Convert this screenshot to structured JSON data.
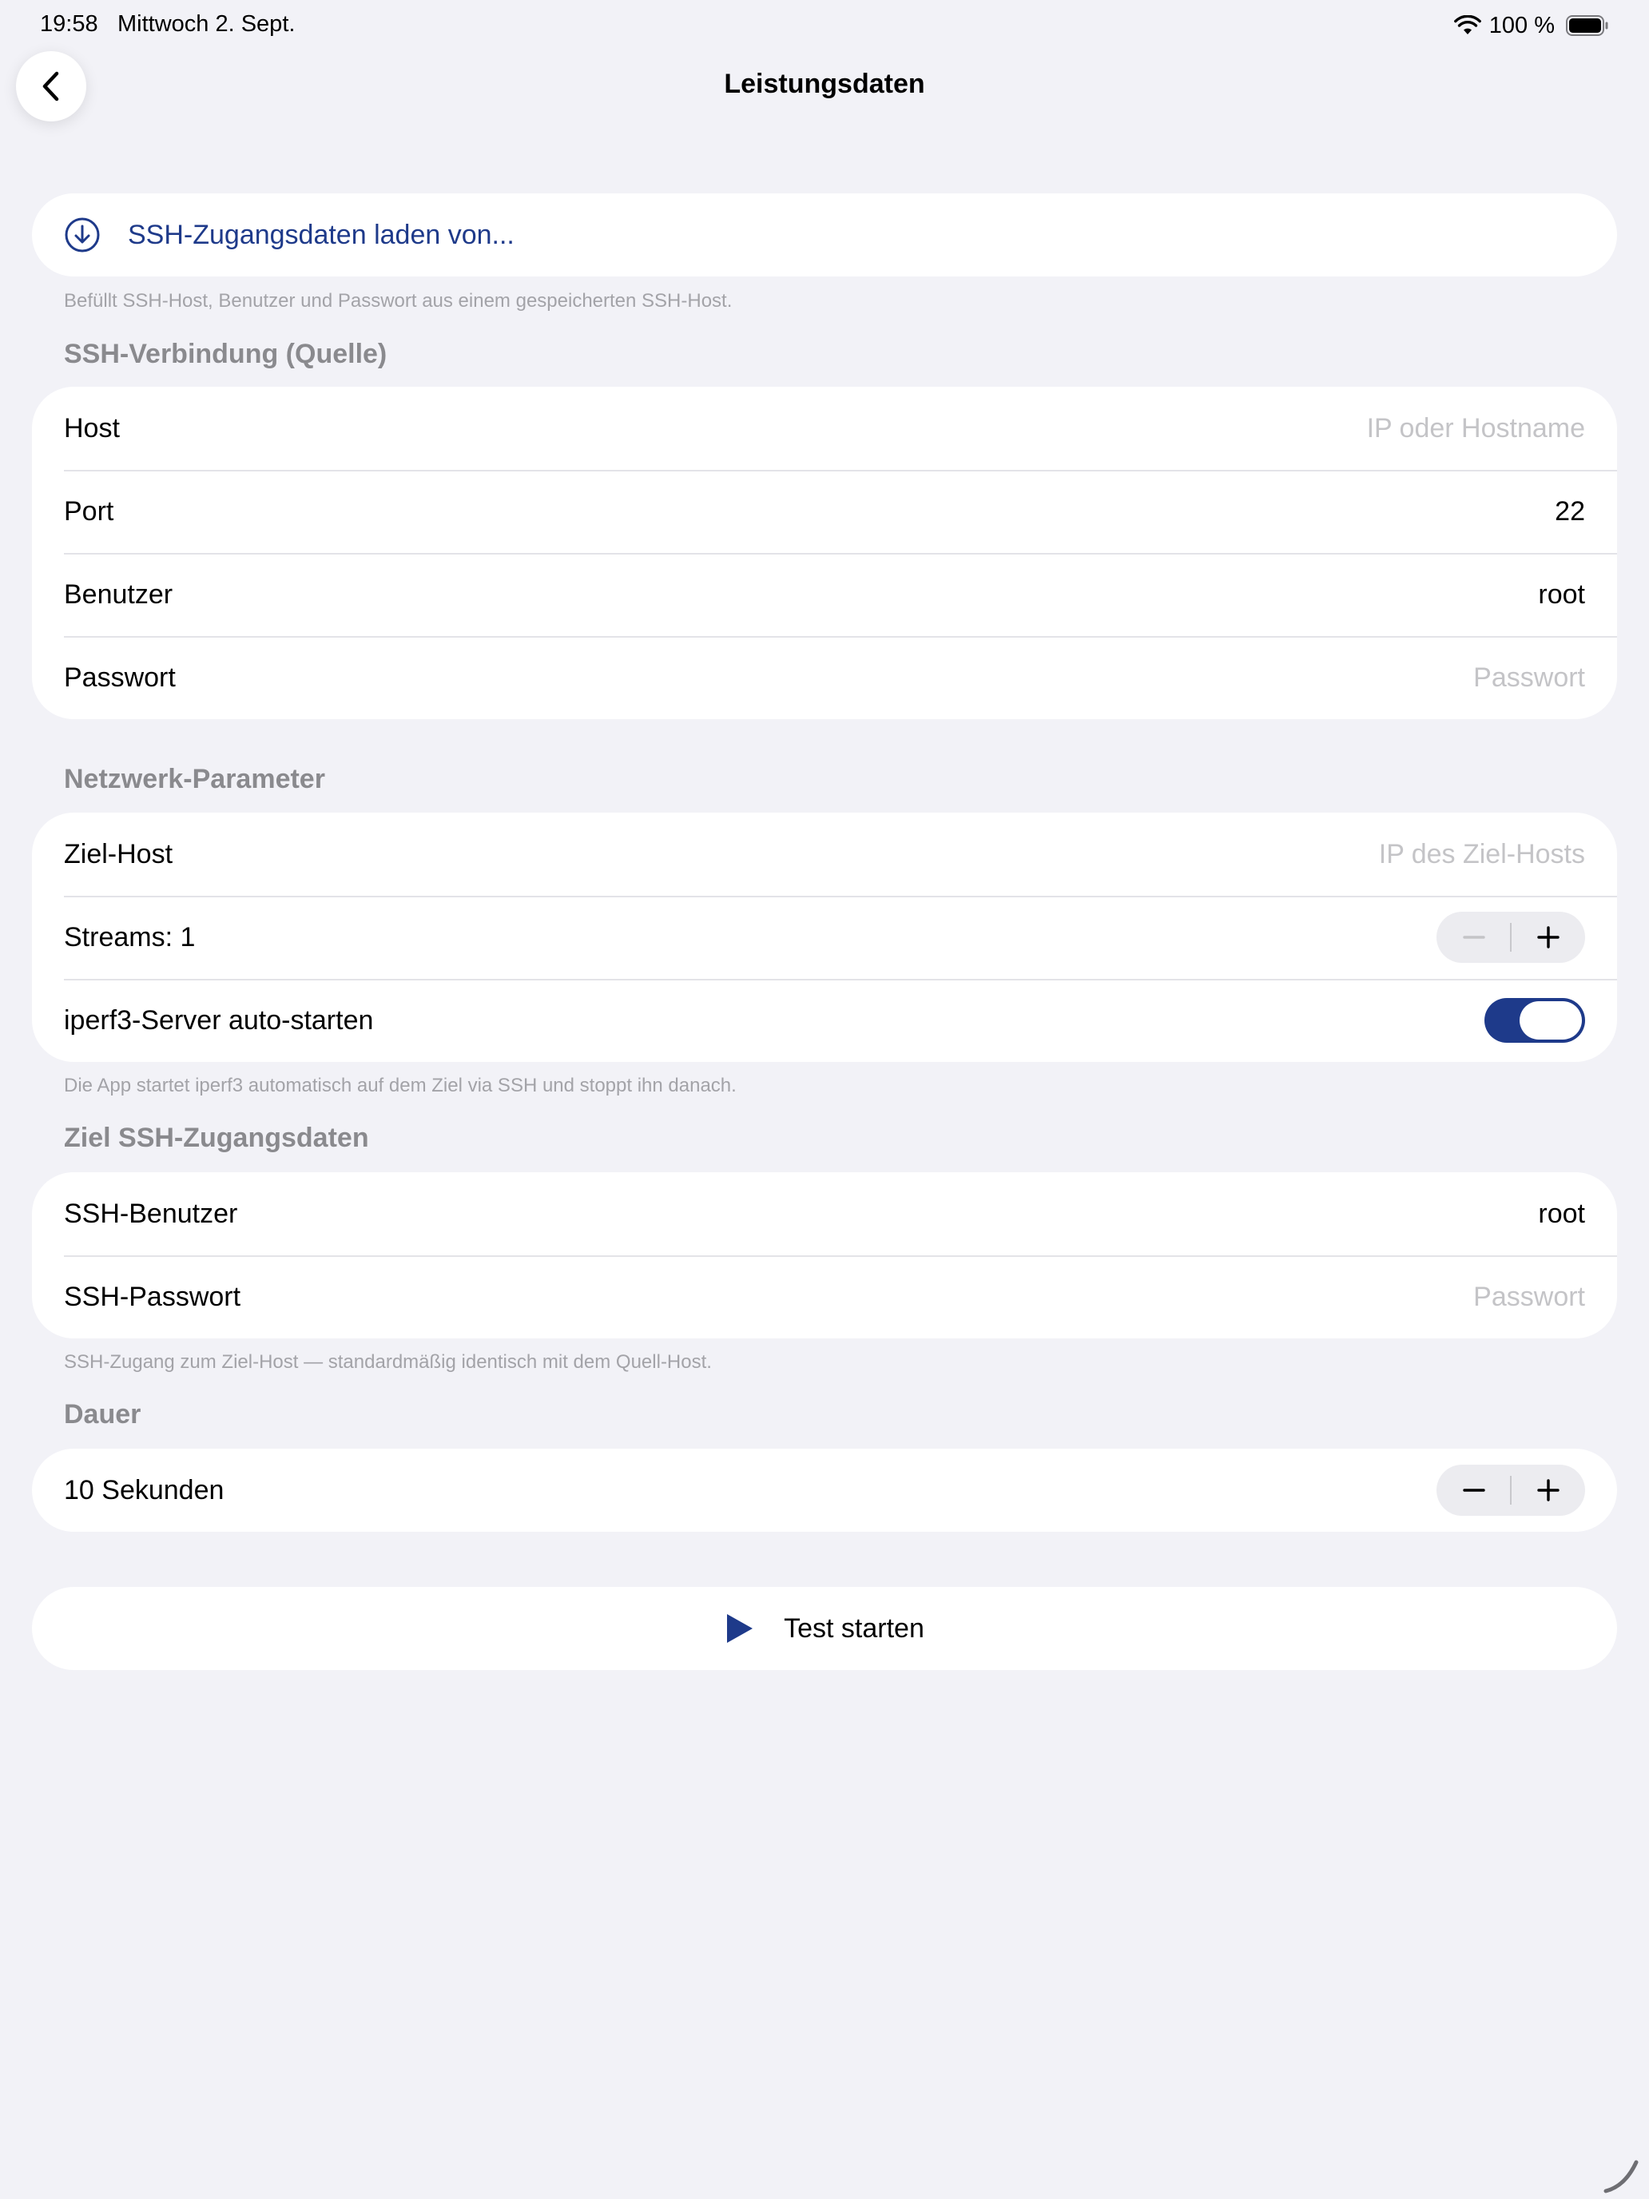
{
  "status": {
    "time": "19:58",
    "date": "Mittwoch 2. Sept.",
    "battery_percent": "100 %"
  },
  "nav": {
    "title": "Leistungsdaten",
    "back_icon": "chevron-left-icon"
  },
  "load": {
    "label": "SSH-Zugangsdaten laden von...",
    "icon": "download-circle-icon",
    "footnote": "Befüllt SSH-Host, Benutzer und Passwort aus einem gespeicherten SSH-Host."
  },
  "ssh_source": {
    "header": "SSH-Verbindung (Quelle)",
    "host_label": "Host",
    "host_placeholder": "IP oder Hostname",
    "port_label": "Port",
    "port_value": "22",
    "user_label": "Benutzer",
    "user_value": "root",
    "password_label": "Passwort",
    "password_placeholder": "Passwort"
  },
  "network": {
    "header": "Netzwerk-Parameter",
    "target_label": "Ziel-Host",
    "target_placeholder": "IP des Ziel-Hosts",
    "streams_label": "Streams: 1",
    "autostart_label": "iperf3-Server auto-starten",
    "autostart_on": true,
    "footnote": "Die App startet iperf3 automatisch auf dem Ziel via SSH und stoppt ihn danach."
  },
  "target_ssh": {
    "header": "Ziel SSH-Zugangsdaten",
    "user_label": "SSH-Benutzer",
    "user_value": "root",
    "password_label": "SSH-Passwort",
    "password_placeholder": "Passwort",
    "footnote": "SSH-Zugang zum Ziel-Host — standardmäßig identisch mit dem Quell-Host."
  },
  "duration": {
    "header": "Dauer",
    "label": "10 Sekunden"
  },
  "start": {
    "label": "Test starten",
    "icon": "play-icon"
  },
  "colors": {
    "accent": "#1e3a8a",
    "background": "#f2f2f7",
    "placeholder": "#c4c4c7",
    "section_header": "#8a8a8e"
  }
}
